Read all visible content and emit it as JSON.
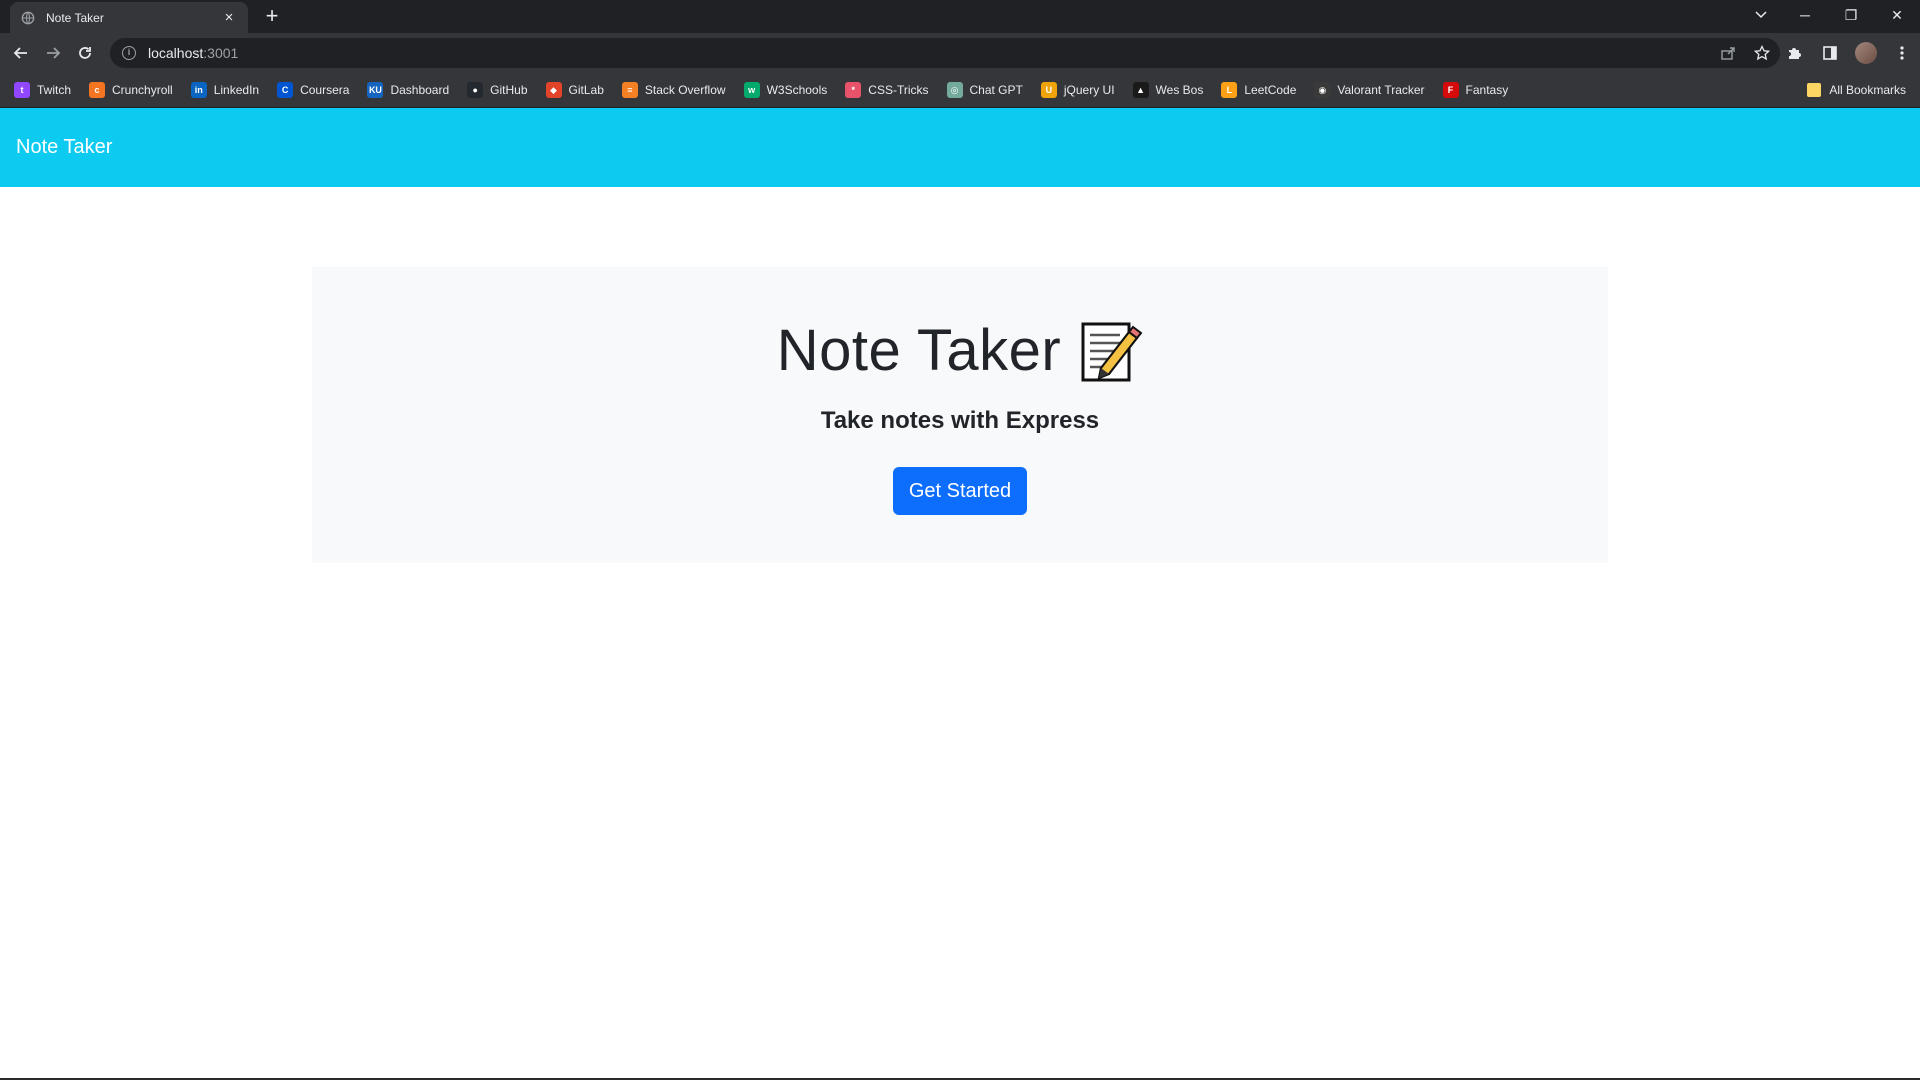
{
  "browser": {
    "tab": {
      "title": "Note Taker",
      "close_glyph": "×",
      "favicon": "globe-icon"
    },
    "new_tab_glyph": "+",
    "window_controls": {
      "minimize": "─",
      "restore": "❐",
      "close": "✕"
    },
    "address": {
      "host": "localhost",
      "port": ":3001"
    },
    "bookmarks": [
      {
        "label": "Twitch",
        "icon": "twitch-icon",
        "color": "#9146ff",
        "glyph": "t"
      },
      {
        "label": "Crunchyroll",
        "icon": "crunchyroll-icon",
        "color": "#f47521",
        "glyph": "c"
      },
      {
        "label": "LinkedIn",
        "icon": "linkedin-icon",
        "color": "#0a66c2",
        "glyph": "in"
      },
      {
        "label": "Coursera",
        "icon": "coursera-icon",
        "color": "#0056d2",
        "glyph": "C"
      },
      {
        "label": "Dashboard",
        "icon": "dashboard-icon",
        "color": "#1565c0",
        "glyph": "KU"
      },
      {
        "label": "GitHub",
        "icon": "github-icon",
        "color": "#24292f",
        "glyph": "●"
      },
      {
        "label": "GitLab",
        "icon": "gitlab-icon",
        "color": "#e24329",
        "glyph": "◆"
      },
      {
        "label": "Stack Overflow",
        "icon": "stackoverflow-icon",
        "color": "#f48024",
        "glyph": "≡"
      },
      {
        "label": "W3Schools",
        "icon": "w3schools-icon",
        "color": "#04aa6d",
        "glyph": "w"
      },
      {
        "label": "CSS-Tricks",
        "icon": "csstricks-icon",
        "color": "#e8526a",
        "glyph": "*"
      },
      {
        "label": "Chat GPT",
        "icon": "chatgpt-icon",
        "color": "#74aa9c",
        "glyph": "◎"
      },
      {
        "label": "jQuery UI",
        "icon": "jqueryui-icon",
        "color": "#f0a30a",
        "glyph": "U"
      },
      {
        "label": "Wes Bos",
        "icon": "wesbos-icon",
        "color": "#1a1a1a",
        "glyph": "▲"
      },
      {
        "label": "LeetCode",
        "icon": "leetcode-icon",
        "color": "#ffa116",
        "glyph": "L"
      },
      {
        "label": "Valorant Tracker",
        "icon": "valorant-tracker-icon",
        "color": "#3a3a3a",
        "glyph": "◉"
      },
      {
        "label": "Fantasy",
        "icon": "fantasy-icon",
        "color": "#d50a0a",
        "glyph": "F"
      }
    ],
    "all_bookmarks_label": "All Bookmarks"
  },
  "page": {
    "navbar": {
      "brand": "Note Taker",
      "color": "#0dcaf0"
    },
    "hero": {
      "title": "Note Taker",
      "icon": "memo-icon",
      "subtitle": "Take notes with Express",
      "button_label": "Get Started",
      "button_color": "#0d6efd"
    }
  }
}
